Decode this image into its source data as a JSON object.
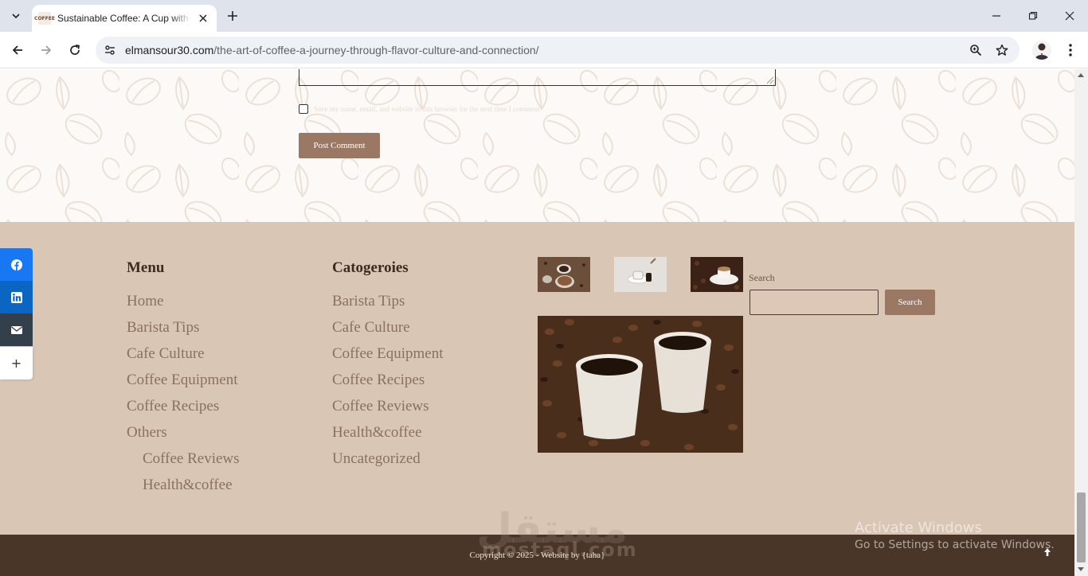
{
  "browser": {
    "tab_title": "Sustainable Coffee: A Cup with a Conscience",
    "favicon_text": "COFFEE",
    "url_host": "elmansour30.com",
    "url_path": "/the-art-of-coffee-a-journey-through-flavor-culture-and-connection/",
    "icons": [
      "tab-list-icon",
      "close-icon",
      "plus-icon",
      "minimize-icon",
      "restore-icon",
      "close-window-icon",
      "back-icon",
      "forward-icon",
      "reload-icon",
      "site-info-icon",
      "zoom-icon",
      "star-icon",
      "avatar",
      "kebab-menu-icon"
    ]
  },
  "comment_form": {
    "consent_label": "Save my name, email, and website in this browser for the next time I comment.",
    "submit_label": "Post Comment"
  },
  "footer": {
    "menu": {
      "title": "Menu",
      "items": [
        "Home",
        "Barista Tips",
        "Cafe Culture",
        "Coffee Equipment",
        "Coffee Recipes",
        "Others"
      ],
      "sub_items": [
        "Coffee Reviews",
        "Health&coffee"
      ]
    },
    "categories": {
      "title": "Catogeroies",
      "items": [
        "Barista Tips",
        "Cafe Culture",
        "Coffee Equipment",
        "Coffee Recipes",
        "Coffee Reviews",
        "Health&coffee",
        "Uncategorized"
      ]
    },
    "search": {
      "label": "Search",
      "button_label": "Search"
    },
    "copyright": "Copyright © 2025 - Website by {taha}"
  },
  "share_bar": {
    "icons": [
      "facebook-icon",
      "linkedin-icon",
      "email-icon",
      "more-icon"
    ],
    "colors": {
      "facebook": "#1877f2",
      "linkedin": "#0a66c2",
      "email": "#333f4a",
      "more": "#ffffff"
    },
    "more_label": "+"
  },
  "watermark": {
    "arabic": "مستقل",
    "latin": "mostaql.com"
  },
  "windows_activation": {
    "title": "Activate Windows",
    "subtitle": "Go to Settings to activate Windows."
  },
  "colors": {
    "footer_bg": "#dac6b4",
    "bottom_bar_bg": "#4a3628",
    "button_bg": "#9b7863",
    "link_color": "#8a7060",
    "heading_color": "#3d2b20"
  }
}
